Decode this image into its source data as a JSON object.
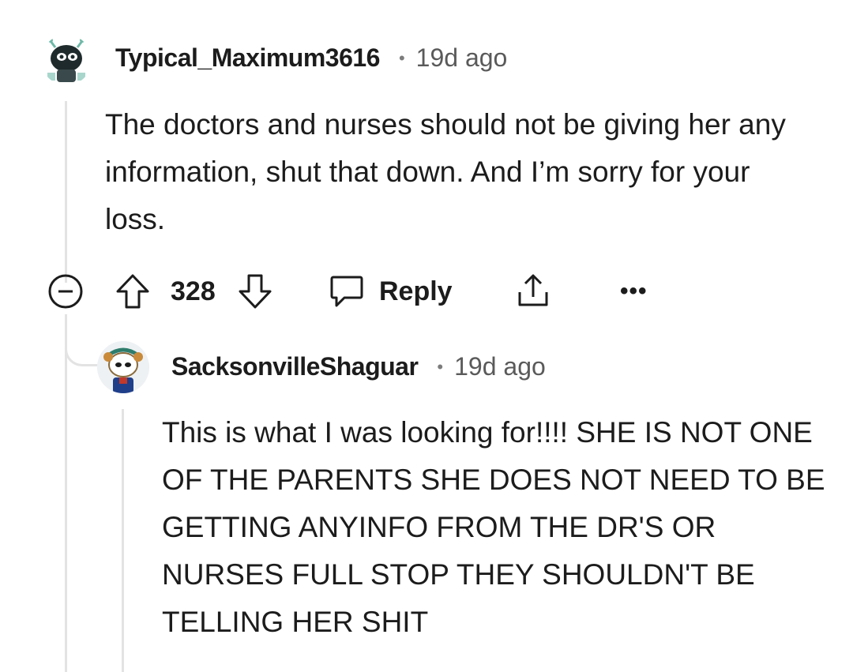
{
  "comment": {
    "username": "Typical_Maximum3616",
    "separator": "•",
    "time": "19d ago",
    "body": "The doctors and nurses should not be giving her any information, shut that down. And I’m sorry for your loss.",
    "score": "328",
    "reply_label": "Reply",
    "more_label": "•••",
    "icons": {
      "collapse": "collapse-icon",
      "upvote": "upvote-icon",
      "downvote": "downvote-icon",
      "reply": "reply-icon",
      "share": "share-icon",
      "more": "more-icon"
    }
  },
  "reply": {
    "username": "SacksonvilleShaguar",
    "separator": "•",
    "time": "19d ago",
    "body": "This is what I was looking for!!!! SHE IS NOT ONE OF THE PARENTS SHE DOES NOT NEED TO BE GETTING ANYINFO FROM THE DR'S OR NURSES FULL STOP THEY SHOULDN'T BE TELLING HER SHIT"
  },
  "colors": {
    "thread_line": "#e3e3e3",
    "text": "#1c1c1c",
    "meta_text": "#5a5a5a"
  }
}
